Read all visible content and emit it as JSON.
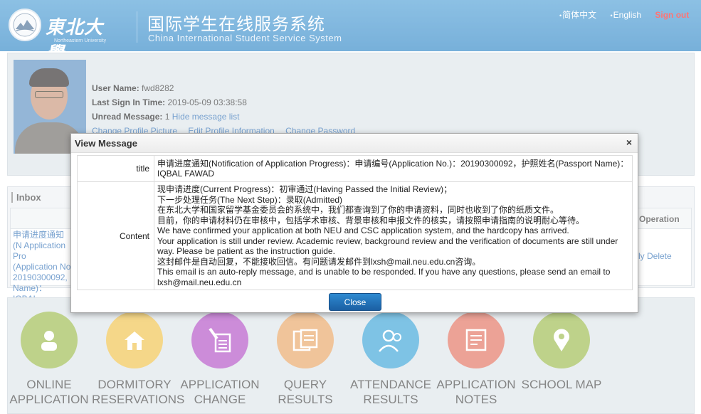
{
  "header": {
    "logo_cn": "東北大學",
    "logo_en": "Northeastern University",
    "system_title_cn": "国际学生在线服务系统",
    "system_title_en": "China International Student Service System",
    "lang_cn": "简体中文",
    "lang_en": "English",
    "sign_out": "Sign out",
    "colors": {
      "bar": "#2f86c6",
      "sign_out": "#ff2a2a"
    }
  },
  "profile": {
    "user_name_label": "User Name:",
    "user_name": "fwd8282",
    "last_sign_in_label": "Last Sign In Time:",
    "last_sign_in": "2019-05-09 03:38:58",
    "unread_label": "Unread Message:",
    "unread_count": "1",
    "hide_message_list": "Hide message list",
    "links": [
      "Change Profile Picture",
      "Edit Profile Information",
      "Change Password"
    ]
  },
  "inbox": {
    "title": "Inbox",
    "operation_header": "Operation",
    "message_preview": "申请进度通知(N Application Pro (Application No 20190300092, Name)：IQBAL",
    "delete_link": "ly Delete"
  },
  "tiles": [
    {
      "icon": "user-icon",
      "color": "#9bbb4c",
      "line1": "ONLINE",
      "line2": "APPLICATION"
    },
    {
      "icon": "house-icon",
      "color": "#f0c24a",
      "line1": "DORMITORY",
      "line2": "RESERVATIONS"
    },
    {
      "icon": "pen-document-icon",
      "color": "#b14fc5",
      "line1": "APPLICATION",
      "line2": "CHANGE"
    },
    {
      "icon": "query-icon",
      "color": "#e8a565",
      "line1": "QUERY",
      "line2": "RESULTS"
    },
    {
      "icon": "attendance-icon",
      "color": "#3aa3d8",
      "line1": "ATTENDANCE",
      "line2": "RESULTS"
    },
    {
      "icon": "notes-icon",
      "color": "#e2715f",
      "line1": "APPLICATION",
      "line2": "NOTES"
    },
    {
      "icon": "map-pin-icon",
      "color": "#9bbb4c",
      "line1": "SCHOOL MAP",
      "line2": ""
    }
  ],
  "modal": {
    "title": "View Message",
    "close_x": "×",
    "title_label": "title",
    "title_value": "申请进度通知(Notification of Application Progress)：申请编号(Application No.)：20190300092，护照姓名(Passport Name)：IQBAL FAWAD",
    "content_label": "Content",
    "content_lines": [
      "现申请进度(Current Progress)：初审通过(Having Passed the Initial Review)；",
      "下一步处理任务(The Next Step)：录取(Admitted)",
      "在东北大学和国家留学基金委员会的系统中，我们都查询到了你的申请资料，同时也收到了你的纸质文件。",
      "目前，你的申请材料仍在审核中，包括学术审核、背景审核和申报文件的核实，请按照申请指南的说明耐心等待。",
      "We have confirmed your application at both NEU and CSC application system, and the hardcopy has arrived.",
      "Your application is still under review. Academic review, background review and the verification of documents are still under way. Please be patient as the instruction guide.",
      "这封邮件是自动回复，不能接收回信。有问题请发邮件到lxsh@mail.neu.edu.cn咨询。",
      "This email is an auto-reply message, and is unable to be responded. If you have any questions, please send an email to lxsh@mail.neu.edu.cn"
    ],
    "close_button": "Close"
  }
}
